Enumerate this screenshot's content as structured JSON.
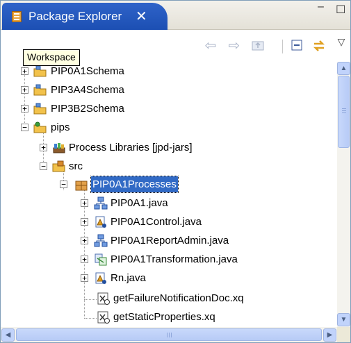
{
  "view": {
    "tab_label": "Package Explorer",
    "close_glyph": "✕",
    "minimize_glyph": "–",
    "maximize_glyph": "☐"
  },
  "toolbar": {
    "back_icon": "arrow-left-icon",
    "forward_icon": "arrow-right-icon",
    "up_icon": "up-folder-icon",
    "collapse_icon": "collapse-all-icon",
    "link_icon": "link-with-editor-icon",
    "menu_icon": "view-menu-icon"
  },
  "tooltip": {
    "text": "Workspace"
  },
  "tree": {
    "items": [
      {
        "label": "PIP0A1Schema",
        "expander": "+",
        "icon": "project-icon"
      },
      {
        "label": "PIP3A4Schema",
        "expander": "+",
        "icon": "project-icon"
      },
      {
        "label": "PIP3B2Schema",
        "expander": "+",
        "icon": "project-icon"
      },
      {
        "label": "pips",
        "expander": "−",
        "icon": "project-icon"
      },
      {
        "label": "Process Libraries [jpd-jars]",
        "expander": "+",
        "icon": "library-icon"
      },
      {
        "label": "src",
        "expander": "−",
        "icon": "source-folder-icon"
      },
      {
        "label": "PIP0A1Processes",
        "expander": "−",
        "icon": "package-icon",
        "selected": true
      },
      {
        "label": "PIP0A1.java",
        "expander": "+",
        "icon": "process-java-icon"
      },
      {
        "label": "PIP0A1Control.java",
        "expander": "+",
        "icon": "control-java-icon"
      },
      {
        "label": "PIP0A1ReportAdmin.java",
        "expander": "+",
        "icon": "process-java-icon"
      },
      {
        "label": "PIP0A1Transformation.java",
        "expander": "+",
        "icon": "transformation-java-icon"
      },
      {
        "label": "Rn.java",
        "expander": "+",
        "icon": "control-java-icon"
      },
      {
        "label": "getFailureNotificationDoc.xq",
        "expander": "",
        "icon": "xquery-file-icon"
      },
      {
        "label": "getStaticProperties.xq",
        "expander": "",
        "icon": "xquery-file-icon"
      }
    ]
  },
  "scroll": {
    "up": "▲",
    "down": "▼",
    "left": "◀",
    "right": "▶"
  },
  "colors": {
    "tab_active": "#2f63c9",
    "selection": "#316ac5",
    "tooltip_bg": "#ffffe1"
  }
}
